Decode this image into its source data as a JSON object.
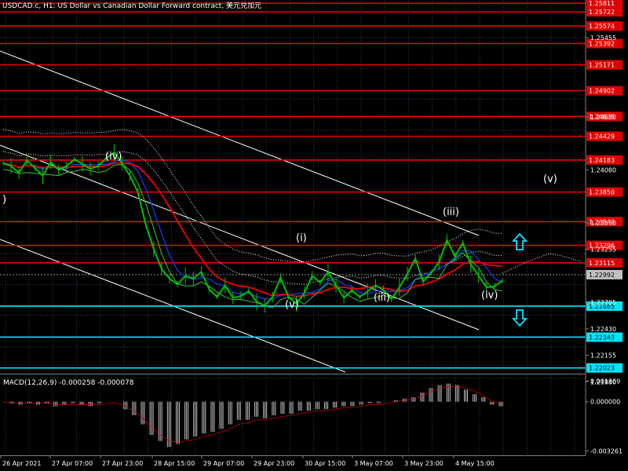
{
  "header": {
    "title": "USDCAD.c, H1:  US Dollar vs Canadian Dollar Forward contract, 美元兑加元"
  },
  "colors": {
    "background": "#000000",
    "grid": "#3a3a5a",
    "price_line": "#00c000",
    "ma_red": "#e00000",
    "ma_blue": "#1040ff",
    "ma_green": "#40c040",
    "level_red": "#e00000",
    "level_cyan": "#00e5ff",
    "channel": "#ffffff",
    "macd_hist": "#c0c0c0",
    "macd_signal": "#e00000"
  },
  "chart_data": [
    {
      "type": "line",
      "symbol": "USDCAD.c",
      "timeframe": "H1",
      "ylim": [
        1.2198,
        1.2582
      ],
      "y_ticks": [
        "1.25455",
        "1.25135",
        "1.24815",
        "1.24490",
        "1.24170",
        "1.23850",
        "1.23530",
        "1.23210",
        "1.22890",
        "1.22570",
        "1.22240",
        "1.21920"
      ],
      "visible_tick_labels": [
        "1.25455",
        "1.24630",
        "1.24080",
        "1.23530",
        "1.23255",
        "1.22705",
        "1.22430",
        "1.22155",
        "1.21880"
      ],
      "x_ticks": [
        "26 Apr 2021",
        "27 Apr 07:00",
        "27 Apr 23:00",
        "28 Apr 15:00",
        "29 Apr 07:00",
        "29 Apr 23:00",
        "30 Apr 15:00",
        "3 May 07:00",
        "3 May 23:00",
        "4 May 15:00"
      ],
      "levels_red": [
        "1.25811",
        "1.25722",
        "1.25574",
        "1.25392",
        "1.25171",
        "1.24902",
        "1.24635",
        "1.24429",
        "1.24183",
        "1.23850",
        "1.23543",
        "1.23296",
        "1.23115"
      ],
      "levels_cyan": [
        "1.22665",
        "1.22343",
        "1.22023"
      ],
      "current_price": "1.22992",
      "price_series": [
        1.2415,
        1.2412,
        1.2405,
        1.2418,
        1.241,
        1.2402,
        1.2416,
        1.2408,
        1.2412,
        1.2419,
        1.2414,
        1.2409,
        1.2412,
        1.242,
        1.2426,
        1.2415,
        1.2402,
        1.2385,
        1.2351,
        1.2326,
        1.2305,
        1.2295,
        1.2289,
        1.2298,
        1.2295,
        1.2302,
        1.2284,
        1.2276,
        1.2288,
        1.2275,
        1.2277,
        1.2282,
        1.2271,
        1.2267,
        1.2276,
        1.2296,
        1.2276,
        1.2269,
        1.228,
        1.2298,
        1.2291,
        1.2302,
        1.2288,
        1.2275,
        1.2283,
        1.2276,
        1.2282,
        1.2288,
        1.2283,
        1.2274,
        1.2286,
        1.23,
        1.2316,
        1.2292,
        1.2301,
        1.2312,
        1.2335,
        1.2318,
        1.2332,
        1.231,
        1.2298,
        1.2286,
        1.2287,
        1.2293
      ],
      "wave_labels": [
        ")",
        "(iv)",
        "(i)",
        "(v)",
        "(iii)",
        "(iii)",
        "(iv)",
        "(v)"
      ],
      "arrows": [
        "up",
        "down"
      ]
    },
    {
      "type": "bar",
      "name": "MACD(12,26,9)",
      "header_text": "MACD(12,26,9) -0.000258 -0.000078",
      "y_ticks": [
        "0.001369",
        "0.000000",
        "-0.003261"
      ],
      "ylim": [
        -0.00345,
        0.00165
      ],
      "macd_values": [
        0.0,
        -0.0001,
        -0.0002,
        -0.0001,
        -0.0002,
        -0.0001,
        -0.0003,
        -0.0002,
        -0.0001,
        -0.0002,
        -0.0003,
        -0.0001,
        0.0,
        0.0,
        -0.0005,
        -0.0009,
        -0.0015,
        -0.0022,
        -0.0026,
        -0.003,
        -0.0028,
        -0.0025,
        -0.0023,
        -0.0021,
        -0.002,
        -0.0018,
        -0.0015,
        -0.0012,
        -0.0012,
        -0.001,
        -0.0011,
        -0.0009,
        -0.0008,
        -0.0008,
        -0.0006,
        -0.0006,
        -0.0005,
        -0.0005,
        -0.0004,
        -0.0003,
        -0.0003,
        -0.0002,
        -0.0001,
        -0.0001,
        0.0,
        0.0001,
        0.0002,
        0.0003,
        0.0006,
        0.0009,
        0.0011,
        0.0012,
        0.0011,
        0.0008,
        0.0005,
        0.0003,
        -0.0002,
        -0.0003
      ],
      "signal_values": [
        0.0,
        -0.0001,
        -0.0001,
        -0.0001,
        -0.0001,
        -0.0001,
        -0.0002,
        -0.0002,
        -0.0002,
        -0.0002,
        -0.0002,
        -0.0002,
        -0.0001,
        -0.0001,
        -0.0003,
        -0.0006,
        -0.0011,
        -0.0017,
        -0.0022,
        -0.0026,
        -0.0027,
        -0.0026,
        -0.0025,
        -0.0023,
        -0.0022,
        -0.002,
        -0.0018,
        -0.0015,
        -0.0014,
        -0.0012,
        -0.0012,
        -0.0011,
        -0.001,
        -0.0009,
        -0.0008,
        -0.0007,
        -0.0006,
        -0.0006,
        -0.0005,
        -0.0004,
        -0.0004,
        -0.0003,
        -0.0002,
        -0.0002,
        -0.0001,
        0.0,
        0.0001,
        0.0002,
        0.0004,
        0.0007,
        0.0009,
        0.001,
        0.001,
        0.0009,
        0.0007,
        0.0004,
        0.0,
        -0.0001
      ]
    }
  ]
}
